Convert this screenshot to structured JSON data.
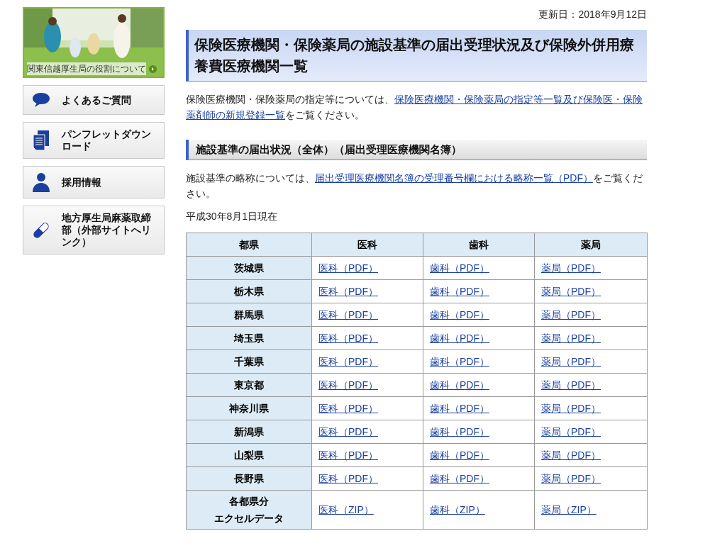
{
  "sidebar": {
    "banner": {
      "kind": "picture",
      "caption": "関東信越厚生局の役割について"
    },
    "items": [
      {
        "kind": "faq",
        "label": "よくあるご質問"
      },
      {
        "kind": "pamphlet",
        "label": "パンフレットダウンロード"
      },
      {
        "kind": "recruit",
        "label": "採用情報"
      },
      {
        "kind": "narcotics",
        "label": "地方厚生局麻薬取締部（外部サイトへリンク）"
      }
    ]
  },
  "updated": "更新日：2018年9月12日",
  "title": "保険医療機関・保険薬局の施設基準の届出受理状況及び保険外併用療養費医療機関一覧",
  "intro": {
    "before": "保険医療機関・保険薬局の指定等については、",
    "link_lines": [
      "保険医療機関・保険薬局の指定等一覧及び保険医・保険",
      "薬剤師の新規登録一覧"
    ],
    "after": "をご覧ください。"
  },
  "section_title": "施設基準の届出状況（全体）（届出受理医療機関名簿）",
  "note": {
    "before": "施設基準の略称については、",
    "link": "届出受理医療機関名簿の受理番号欄における略称一覧（PDF）",
    "after": "をご覧ください。"
  },
  "as_of": "平成30年8月1日現在",
  "table": {
    "columns": [
      "都県",
      "医科",
      "歯科",
      "薬局"
    ],
    "rows": [
      {
        "name": "茨城県",
        "links": [
          "医科（PDF）",
          "歯科（PDF）",
          "薬局（PDF）"
        ]
      },
      {
        "name": "栃木県",
        "links": [
          "医科（PDF）",
          "歯科（PDF）",
          "薬局（PDF）"
        ]
      },
      {
        "name": "群馬県",
        "links": [
          "医科（PDF）",
          "歯科（PDF）",
          "薬局（PDF）"
        ]
      },
      {
        "name": "埼玉県",
        "links": [
          "医科（PDF）",
          "歯科（PDF）",
          "薬局（PDF）"
        ]
      },
      {
        "name": "千葉県",
        "links": [
          "医科（PDF）",
          "歯科（PDF）",
          "薬局（PDF）"
        ]
      },
      {
        "name": "東京都",
        "links": [
          "医科（PDF）",
          "歯科（PDF）",
          "薬局（PDF）"
        ]
      },
      {
        "name": "神奈川県",
        "links": [
          "医科（PDF）",
          "歯科（PDF）",
          "薬局（PDF）"
        ]
      },
      {
        "name": "新潟県",
        "links": [
          "医科（PDF）",
          "歯科（PDF）",
          "薬局（PDF）"
        ]
      },
      {
        "name": "山梨県",
        "links": [
          "医科（PDF）",
          "歯科（PDF）",
          "薬局（PDF）"
        ]
      },
      {
        "name": "長野県",
        "links": [
          "医科（PDF）",
          "歯科（PDF）",
          "薬局（PDF）"
        ]
      },
      {
        "name": "各都県分",
        "name_2": "エクセルデータ",
        "links": [
          "医科（ZIP）",
          "歯科（ZIP）",
          "薬局（ZIP）"
        ]
      }
    ]
  }
}
